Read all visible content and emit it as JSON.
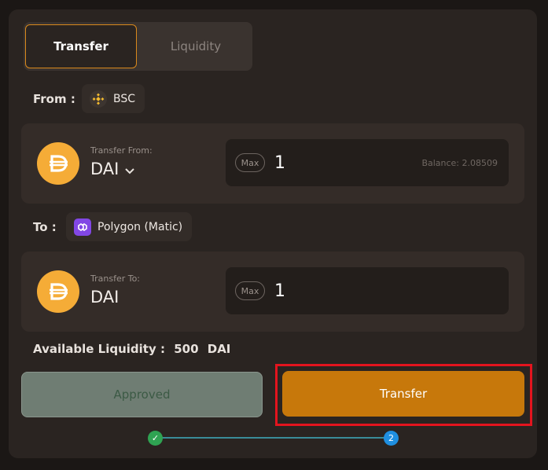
{
  "tabs": {
    "transfer": "Transfer",
    "liquidity": "Liquidity"
  },
  "from": {
    "label": "From :",
    "chain": "BSC",
    "token_sub": "Transfer From:",
    "token": "DAI",
    "max_label": "Max",
    "amount": "1",
    "balance": "Balance: 2.08509"
  },
  "to": {
    "label": "To :",
    "chain": "Polygon (Matic)",
    "token_sub": "Transfer To:",
    "token": "DAI",
    "max_label": "Max",
    "amount": "1"
  },
  "liquidity": {
    "label": "Available Liquidity :",
    "amount": "500",
    "unit": "DAI"
  },
  "buttons": {
    "approved": "Approved",
    "transfer": "Transfer"
  },
  "stepper": {
    "step1": "✓",
    "step2": "2"
  },
  "colors": {
    "accent": "#c7780b",
    "approved": "#6f7d73",
    "highlight": "#e3141e",
    "dai": "#f5ac37",
    "polygon": "#8247e5",
    "bsc": "#f3ba2f"
  }
}
